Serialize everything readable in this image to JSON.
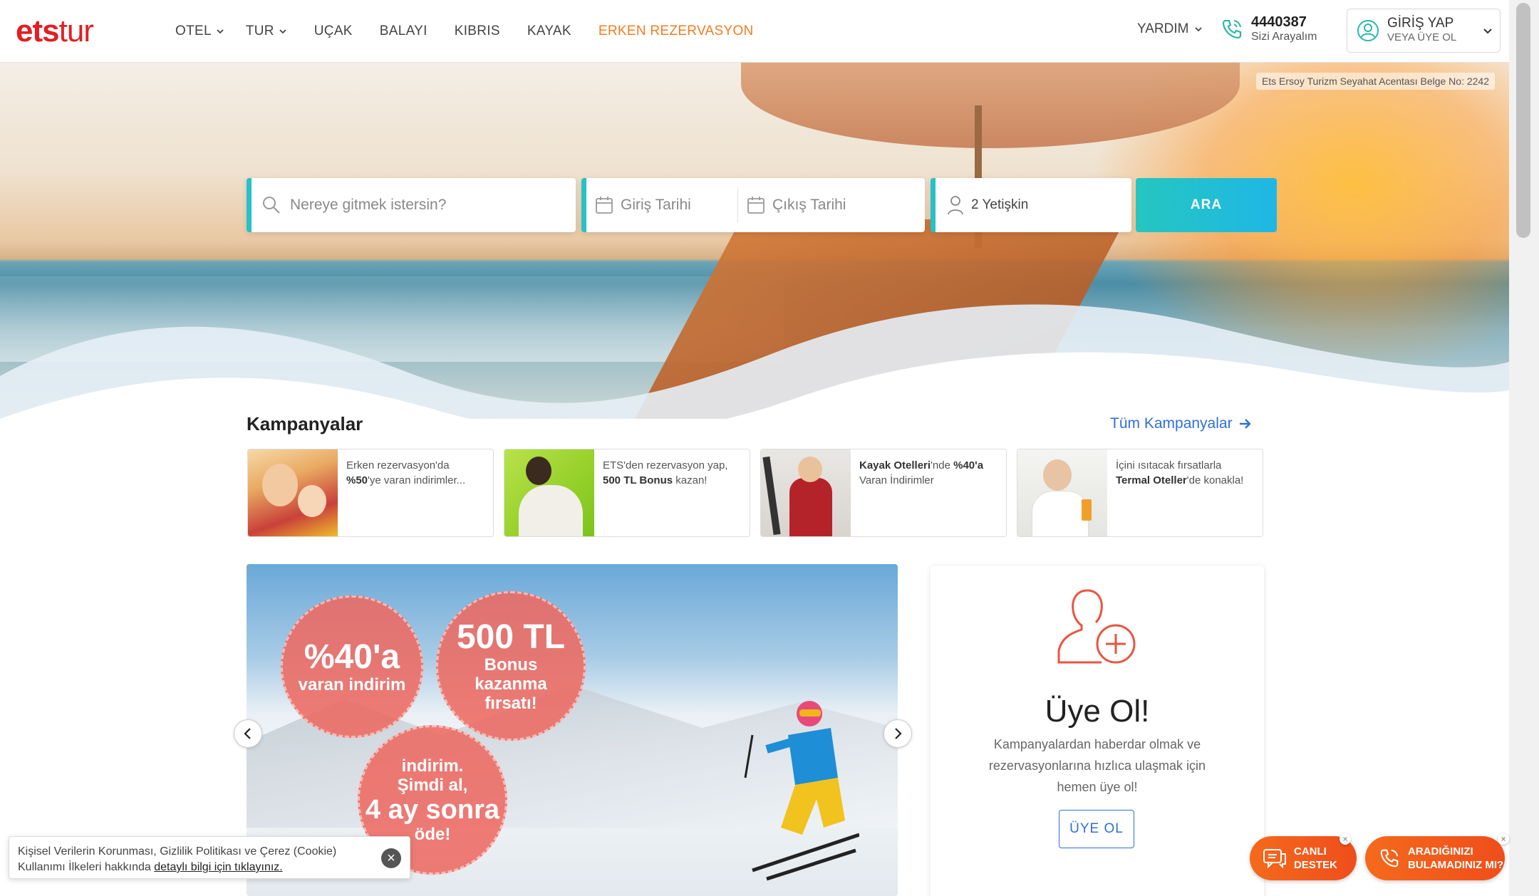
{
  "header": {
    "logo_ets": "ets",
    "logo_tur": "tur",
    "nav": [
      {
        "label": "OTEL",
        "dropdown": true
      },
      {
        "label": "TUR",
        "dropdown": true
      },
      {
        "label": "UÇAK"
      },
      {
        "label": "BALAYI"
      },
      {
        "label": "KIBRIS"
      },
      {
        "label": "KAYAK"
      },
      {
        "label": "ERKEN REZERVASYON",
        "color": "#f47c20"
      }
    ],
    "help_label": "YARDIM",
    "phone_number": "4440387",
    "phone_sub": "Sizi Arayalım",
    "login_line1": "GİRİŞ YAP",
    "login_line2": "VEYA ÜYE OL"
  },
  "hero": {
    "license": "Ets Ersoy Turizm Seyahat Acentası  Belge No: 2242"
  },
  "search": {
    "destination_placeholder": "Nereye gitmek istersin?",
    "checkin_placeholder": "Giriş Tarihi",
    "checkout_placeholder": "Çıkış Tarihi",
    "guests": "2 Yetişkin",
    "button": "ARA"
  },
  "campaigns": {
    "title": "Kampanyalar",
    "all_link": "Tüm Kampanyalar",
    "items": [
      {
        "pre": "Erken rezervasyon'da ",
        "bold": "%50",
        "post": "'ye varan indirimler..."
      },
      {
        "pre": "ETS'den rezervasyon yap, ",
        "bold": "500 TL Bonus",
        "post": " kazan!"
      },
      {
        "bold": "Kayak Otelleri",
        "pre2": "'nde ",
        "bold2": "%40'a",
        "post": " Varan İndirimler"
      },
      {
        "pre": "İçini ısıtacak fırsatlarla ",
        "bold": "Termal Oteller",
        "post": "'de konakla!"
      }
    ]
  },
  "banner": {
    "badge1_big": "%40'a",
    "badge1_sm": "varan indirim",
    "badge2_big": "500 TL",
    "badge2_sm": "Bonus kazanma fırsatı!",
    "badge3_top": "indirim.",
    "badge3_mid": "Şimdi al,",
    "badge3_big": "4 ay sonra",
    "badge3_sm": "öde!"
  },
  "signup": {
    "title": "Üye Ol!",
    "desc": "Kampanyalardan haberdar olmak ve rezervasyonlarına hızlıca ulaşmak için hemen üye ol!",
    "button": "ÜYE OL"
  },
  "cookie": {
    "text": "Kişisel Verilerin Korunması, Gizlilik Politikası ve Çerez (Cookie) Kullanımı İlkeleri hakkında ",
    "link": "detaylı bilgi için tıklayınız."
  },
  "floating": {
    "live_line1": "CANLI",
    "live_line2": "DESTEK",
    "search_line1": "ARADIĞINIZI",
    "search_line2": "BULAMADINIZ MI?"
  },
  "colors": {
    "brand_red": "#e31e24",
    "accent_orange": "#f47c20",
    "teal": "#27c1c7",
    "link_blue": "#2f6fd6"
  }
}
